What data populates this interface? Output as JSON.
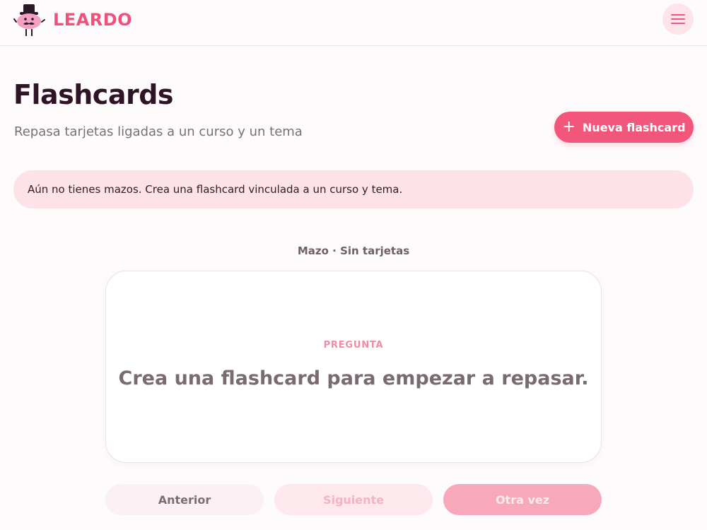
{
  "header": {
    "brand": "LEARDO",
    "menu_icon": "hamburger-menu-icon",
    "logo_icon": "mascot-logo-icon"
  },
  "page": {
    "title": "Flashcards",
    "subtitle": "Repasa tarjetas ligadas a un curso y un tema",
    "new_button_label": "Nueva flashcard",
    "new_button_icon": "plus-icon"
  },
  "alert": {
    "message": "Aún no tienes mazos. Crea una flashcard vinculada a un curso y tema."
  },
  "deck": {
    "label": "Mazo · Sin tarjetas"
  },
  "card": {
    "kicker": "PREGUNTA",
    "text": "Crea una flashcard para empezar a repasar."
  },
  "controls": {
    "previous": "Anterior",
    "next": "Siguiente",
    "again": "Otra vez"
  },
  "colors": {
    "brand": "#f0507a",
    "accent_button": "#f2567a",
    "alert_bg": "#fde3e8"
  }
}
